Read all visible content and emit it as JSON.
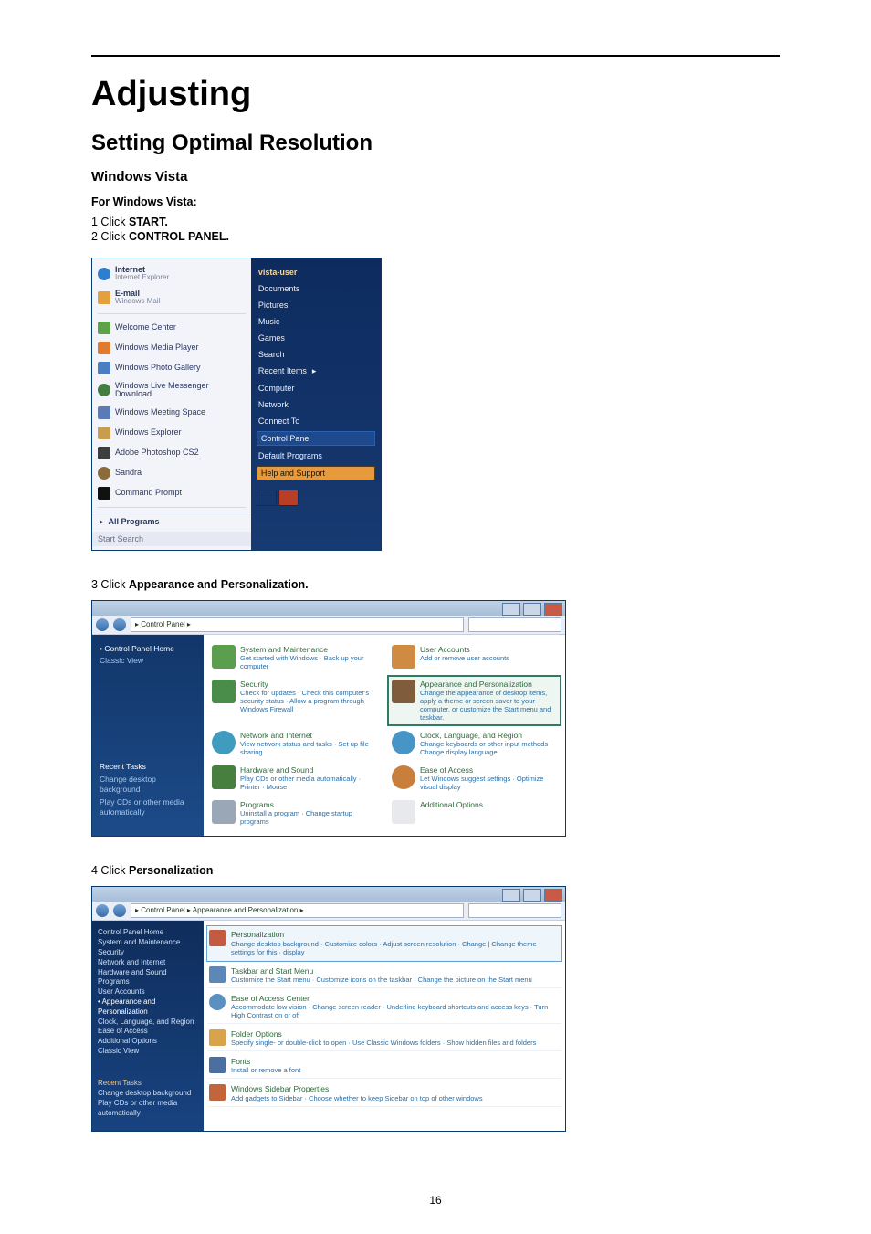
{
  "page_number": "16",
  "h1": "Adjusting",
  "h2": "Setting Optimal Resolution",
  "h3": "Windows Vista",
  "h4": "For Windows Vista:",
  "step1_num": "1",
  "step1_pre": " Click ",
  "step1_bold": "START.",
  "step2_num": "2",
  "step2_pre": " Click ",
  "step2_bold": "CONTROL PANEL.",
  "step3_num": "3",
  "step3_pre": " Click ",
  "step3_bold": "Appearance and Personalization.",
  "step4_num": "4",
  "step4_pre": " Click ",
  "step4_bold": "Personalization",
  "ss1": {
    "left": {
      "apps": [
        {
          "title": "Internet",
          "sub": "Internet Explorer"
        },
        {
          "title": "E-mail",
          "sub": "Windows Mail"
        },
        {
          "title": "Welcome Center",
          "sub": ""
        },
        {
          "title": "Windows Media Player",
          "sub": ""
        },
        {
          "title": "Windows Photo Gallery",
          "sub": ""
        },
        {
          "title": "Windows Live Messenger Download",
          "sub": ""
        },
        {
          "title": "Windows Meeting Space",
          "sub": ""
        },
        {
          "title": "Windows Explorer",
          "sub": ""
        },
        {
          "title": "Adobe Photoshop CS2",
          "sub": ""
        },
        {
          "title": "Sandra",
          "sub": ""
        },
        {
          "title": "Command Prompt",
          "sub": ""
        }
      ],
      "all_programs": "All Programs",
      "search_placeholder": "Start Search"
    },
    "right": {
      "user": "vista-user",
      "items": [
        "Documents",
        "Pictures",
        "Music",
        "Games",
        "Search",
        "Recent Items",
        "Computer",
        "Network",
        "Connect To"
      ],
      "control_panel": "Control Panel",
      "default_programs": "Default Programs",
      "help": "Help and Support"
    }
  },
  "ss2": {
    "addr": "▸ Control Panel ▸",
    "side_top": {
      "heading": "Control Panel Home",
      "link": "Classic View"
    },
    "side_bottom": {
      "heading": "Recent Tasks",
      "links": [
        "Change desktop background",
        "Play CDs or other media automatically"
      ]
    },
    "cats": [
      {
        "cls": "sm",
        "t1": "System and Maintenance",
        "t2": "Get started with Windows · Back up your computer"
      },
      {
        "cls": "ua",
        "t1": "User Accounts",
        "t2": "Add or remove user accounts"
      },
      {
        "cls": "sec",
        "t1": "Security",
        "t2": "Check for updates · Check this computer's security status · Allow a program through Windows Firewall"
      },
      {
        "cls": "ap",
        "sel": true,
        "t1": "Appearance and Personalization",
        "t2": "Change the appearance of desktop items, apply a theme or screen saver to your computer, or customize the Start menu and taskbar."
      },
      {
        "cls": "net",
        "t1": "Network and Internet",
        "t2": "View network status and tasks · Set up file sharing"
      },
      {
        "cls": "cl",
        "t1": "Clock, Language, and Region",
        "t2": "Change keyboards or other input methods · Change display language"
      },
      {
        "cls": "hw",
        "t1": "Hardware and Sound",
        "t2": "Play CDs or other media automatically · Printer · Mouse"
      },
      {
        "cls": "ea",
        "t1": "Ease of Access",
        "t2": "Let Windows suggest settings · Optimize visual display"
      },
      {
        "cls": "prg",
        "t1": "Programs",
        "t2": "Uninstall a program · Change startup programs"
      },
      {
        "cls": "ao",
        "t1": "Additional Options",
        "t2": ""
      }
    ]
  },
  "ss3": {
    "addr": "▸ Control Panel ▸ Appearance and Personalization ▸",
    "side_top": [
      "Control Panel Home",
      "System and Maintenance",
      "Security",
      "Network and Internet",
      "Hardware and Sound",
      "Programs",
      "User Accounts"
    ],
    "side_current": "Appearance and Personalization",
    "side_after": [
      "Clock, Language, and Region",
      "Ease of Access",
      "Additional Options",
      "Classic View"
    ],
    "side_bottom": {
      "heading": "Recent Tasks",
      "links": [
        "Change desktop background",
        "Play CDs or other media automatically"
      ]
    },
    "items": [
      {
        "cls": "red",
        "hl": true,
        "t1": "Personalization",
        "t2": "Change desktop background · Customize colors · Adjust screen resolution · Change | Change theme settings for this  · display"
      },
      {
        "cls": "",
        "t1": "Taskbar and Start Menu",
        "t2": "Customize the Start menu · Customize icons on the taskbar · Change the picture on the Start menu"
      },
      {
        "cls": "ea",
        "t1": "Ease of Access Center",
        "t2": "Accommodate low vision · Change screen reader · Underline keyboard shortcuts and access keys · Turn High Contrast on or off"
      },
      {
        "cls": "fld",
        "t1": "Folder Options",
        "t2": "Specify single- or double-click to open · Use Classic Windows folders · Show hidden files and folders"
      },
      {
        "cls": "fnt",
        "t1": "Fonts",
        "t2": "Install or remove a font"
      },
      {
        "cls": "wsb",
        "t1": "Windows Sidebar Properties",
        "t2": "Add gadgets to Sidebar · Choose whether to keep Sidebar on top of other windows"
      }
    ]
  }
}
